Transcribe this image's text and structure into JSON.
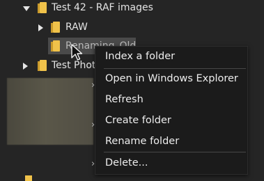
{
  "tree": {
    "items": [
      {
        "label": "Test 42 - RAF images",
        "expanded": true
      },
      {
        "label": "RAW",
        "expanded": false
      },
      {
        "label": "Renaming_Old",
        "selected": true
      },
      {
        "label": "Test Phot",
        "expanded": false
      }
    ]
  },
  "context_menu": {
    "items": [
      "Index a folder",
      "Open in Windows Explorer",
      "Refresh",
      "Create folder",
      "Rename folder",
      "Delete..."
    ]
  },
  "colors": {
    "background": "#252525",
    "menu_background": "#1b1b1b",
    "folder": "#f0c24a",
    "selection": "#4a4a4a"
  }
}
